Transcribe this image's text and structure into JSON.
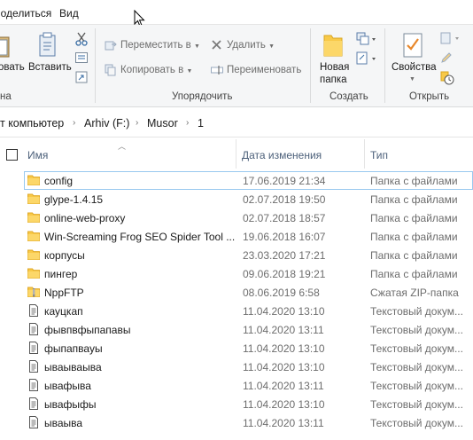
{
  "ribbon_tabs": {
    "share": "Поделиться",
    "view": "Вид"
  },
  "ribbon": {
    "clipboard": {
      "paste_partial": "овать",
      "paste_shortcut": "Вставить",
      "group_partial": "на"
    },
    "organize": {
      "move_to": "Переместить в",
      "copy_to": "Копировать в",
      "delete": "Удалить",
      "rename": "Переименовать",
      "group": "Упорядочить"
    },
    "new": {
      "new_folder_line1": "Новая",
      "new_folder_line2": "папка",
      "group": "Создать"
    },
    "open": {
      "properties": "Свойства",
      "group": "Открыть"
    }
  },
  "address": {
    "crumbs": [
      "т компьютер",
      "Arhiv (F:)",
      "Musor",
      "1"
    ]
  },
  "columns": {
    "name": "Имя",
    "date": "Дата изменения",
    "type": "Тип"
  },
  "files": [
    {
      "name": "config",
      "date": "17.06.2019 21:34",
      "type": "Папка с файлами",
      "icon": "folder-icon"
    },
    {
      "name": "glype-1.4.15",
      "date": "02.07.2018 19:50",
      "type": "Папка с файлами",
      "icon": "folder-icon"
    },
    {
      "name": "online-web-proxy",
      "date": "02.07.2018 18:57",
      "type": "Папка с файлами",
      "icon": "folder-icon"
    },
    {
      "name": "Win-Screaming Frog SEO Spider Tool ...",
      "date": "19.06.2018 16:07",
      "type": "Папка с файлами",
      "icon": "folder-icon"
    },
    {
      "name": "корпусы",
      "date": "23.03.2020 17:21",
      "type": "Папка с файлами",
      "icon": "folder-icon"
    },
    {
      "name": "пингер",
      "date": "09.06.2018 19:21",
      "type": "Папка с файлами",
      "icon": "folder-icon"
    },
    {
      "name": "NppFTP",
      "date": "08.06.2019 6:58",
      "type": "Сжатая ZIP-папка",
      "icon": "zip-folder-icon"
    },
    {
      "name": "кауцкап",
      "date": "11.04.2020 13:10",
      "type": "Текстовый докум...",
      "icon": "text-file-icon"
    },
    {
      "name": "фывпвфыпапавы",
      "date": "11.04.2020 13:11",
      "type": "Текстовый докум...",
      "icon": "text-file-icon"
    },
    {
      "name": "фыпапвауы",
      "date": "11.04.2020 13:10",
      "type": "Текстовый докум...",
      "icon": "text-file-icon"
    },
    {
      "name": "ываываыва",
      "date": "11.04.2020 13:10",
      "type": "Текстовый докум...",
      "icon": "text-file-icon"
    },
    {
      "name": "ывафыва",
      "date": "11.04.2020 13:11",
      "type": "Текстовый докум...",
      "icon": "text-file-icon"
    },
    {
      "name": "ывафыфы",
      "date": "11.04.2020 13:10",
      "type": "Текстовый докум...",
      "icon": "text-file-icon"
    },
    {
      "name": "ываыва",
      "date": "11.04.2020 13:11",
      "type": "Текстовый докум...",
      "icon": "text-file-icon"
    }
  ],
  "colors": {
    "folder": "#f8c948",
    "focus_border": "#99c9ef",
    "header_text": "#4c607a"
  }
}
